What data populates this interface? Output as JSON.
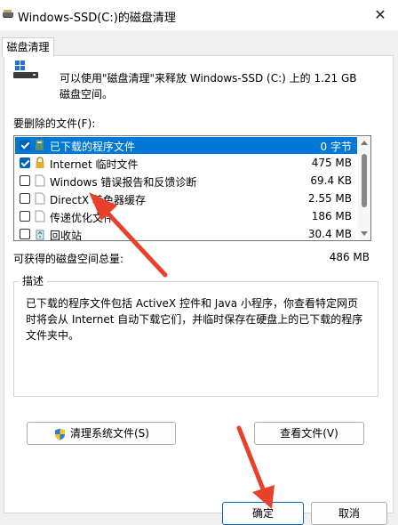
{
  "window": {
    "title": "Windows-SSD(C:)的磁盘清理",
    "close_glyph": "✕"
  },
  "tab": {
    "label": "磁盘清理"
  },
  "intro": {
    "text": "可以使用\"磁盘清理\"来释放 Windows-SSD (C:) 上的 1.21 GB 磁盘空间。"
  },
  "files_label": "要删除的文件(F):",
  "files": [
    {
      "name": "已下载的程序文件",
      "size": "0 字节",
      "checked": true,
      "icon": "folder-icon",
      "selected": true
    },
    {
      "name": "Internet 临时文件",
      "size": "475 MB",
      "checked": true,
      "icon": "lock-icon",
      "selected": false
    },
    {
      "name": "Windows 错误报告和反馈诊断",
      "size": "69.4 KB",
      "checked": false,
      "icon": "file-icon",
      "selected": false
    },
    {
      "name": "DirectX 着色器缓存",
      "size": "2.55 MB",
      "checked": false,
      "icon": "file-icon",
      "selected": false
    },
    {
      "name": "传递优化文件",
      "size": "186 MB",
      "checked": false,
      "icon": "file-icon",
      "selected": false
    },
    {
      "name": "回收站",
      "size": "30.4 MB",
      "checked": false,
      "icon": "recycle-bin-icon",
      "selected": false
    }
  ],
  "total": {
    "label": "可获得的磁盘空间总量:",
    "value": "486 MB"
  },
  "description": {
    "title": "描述",
    "text": "已下载的程序文件包括 ActiveX 控件和 Java 小程序，你查看特定网页时将会从 Internet 自动下载它们，并临时保存在硬盘上的已下载的程序文件夹中。"
  },
  "buttons": {
    "clean_system": "清理系统文件(S)",
    "view_files": "查看文件(V)",
    "ok": "确定",
    "cancel": "取消"
  },
  "colors": {
    "selection": "#0078d7",
    "annotation_arrow": "#e8402a",
    "checkbox": "#0063b1"
  }
}
